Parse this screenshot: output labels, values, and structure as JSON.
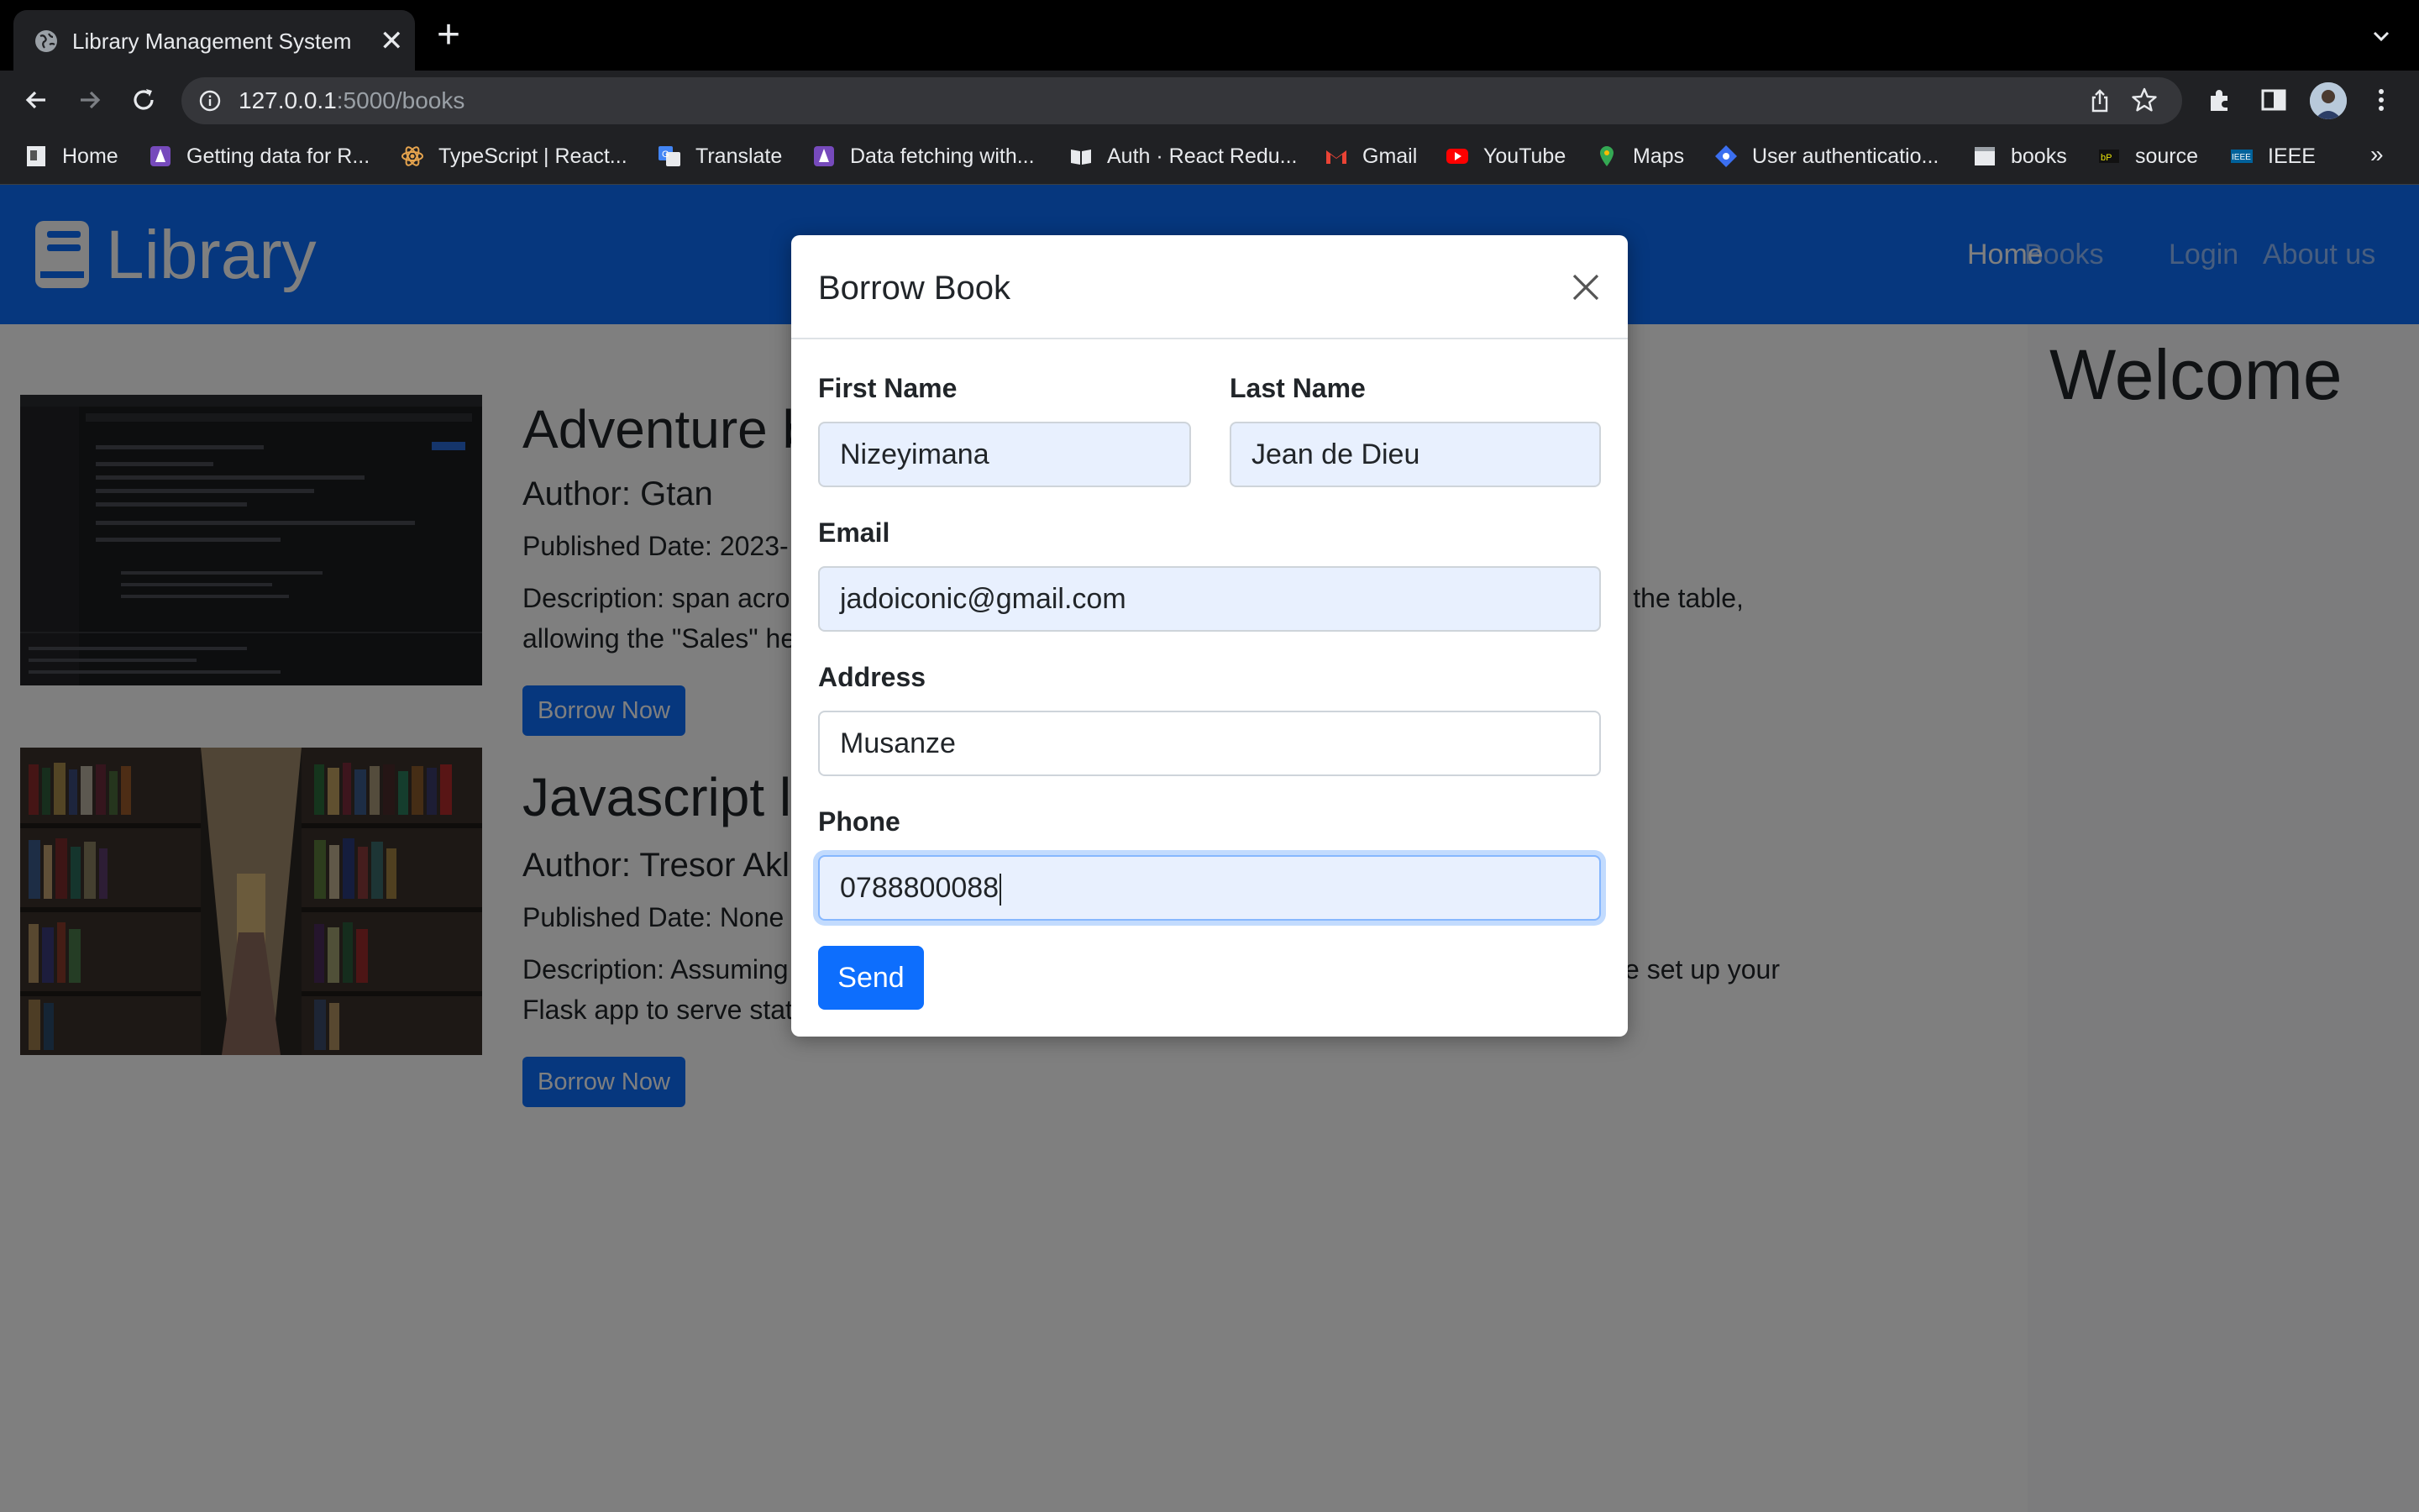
{
  "browser": {
    "tab_title": "Library Management System",
    "tab_close": "✕",
    "new_tab": "+",
    "url_host": "127.0.0.1",
    "url_rest": ":5000/books",
    "bookmarks": [
      {
        "label": "Home",
        "icon": "home-page-icon"
      },
      {
        "label": "Getting data for R...",
        "icon": "purple-rocket-icon"
      },
      {
        "label": "TypeScript | React...",
        "icon": "react-atom-icon"
      },
      {
        "label": "Translate",
        "icon": "google-translate-icon"
      },
      {
        "label": "Data fetching with...",
        "icon": "purple-rocket-icon"
      },
      {
        "label": "Auth · React Redu...",
        "icon": "book-icon"
      },
      {
        "label": "Gmail",
        "icon": "gmail-icon"
      },
      {
        "label": "YouTube",
        "icon": "youtube-icon"
      },
      {
        "label": "Maps",
        "icon": "maps-pin-icon"
      },
      {
        "label": "User authenticatio...",
        "icon": "blue-diamond-icon"
      },
      {
        "label": "books",
        "icon": "white-page-icon"
      },
      {
        "label": "source",
        "icon": "source-logo-icon"
      },
      {
        "label": "IEEE",
        "icon": "ieee-logo-icon"
      }
    ],
    "bookmarks_more": "»"
  },
  "site": {
    "brand": "Library",
    "nav": [
      "Home",
      "Books",
      "Login",
      "About us"
    ],
    "sidebar_heading": "Welcome",
    "colors": {
      "primary": "#0d6efd",
      "backdrop": "rgba(0,0,0,0.5)"
    }
  },
  "books": [
    {
      "title": "Adventure b",
      "author": "Author: Gtan",
      "published": "Published Date: 2023-",
      "desc_line1_left": "Description: span acro",
      "desc_line1_right": "ns of the table,",
      "desc_line2": "allowing the \"Sales\" he",
      "button": "Borrow Now",
      "image": "dark-ide-screenshot"
    },
    {
      "title": "Javascript l",
      "author": "Author: Tresor Akl",
      "published": "Published Date: None",
      "desc_line1_left": "Description: Assuming",
      "desc_line1_right": "ve set up your",
      "desc_line2": "Flask app to serve stat",
      "button": "Borrow Now",
      "image": "library-bookshelves-photo"
    }
  ],
  "modal": {
    "title": "Borrow Book",
    "first_name_label": "First Name",
    "first_name": "Nizeyimana",
    "last_name_label": "Last Name",
    "last_name": "Jean de Dieu",
    "email_label": "Email",
    "email": "jadoiconic@gmail.com",
    "address_label": "Address",
    "address": "Musanze",
    "phone_label": "Phone",
    "phone": "0788800088",
    "send": "Send"
  }
}
